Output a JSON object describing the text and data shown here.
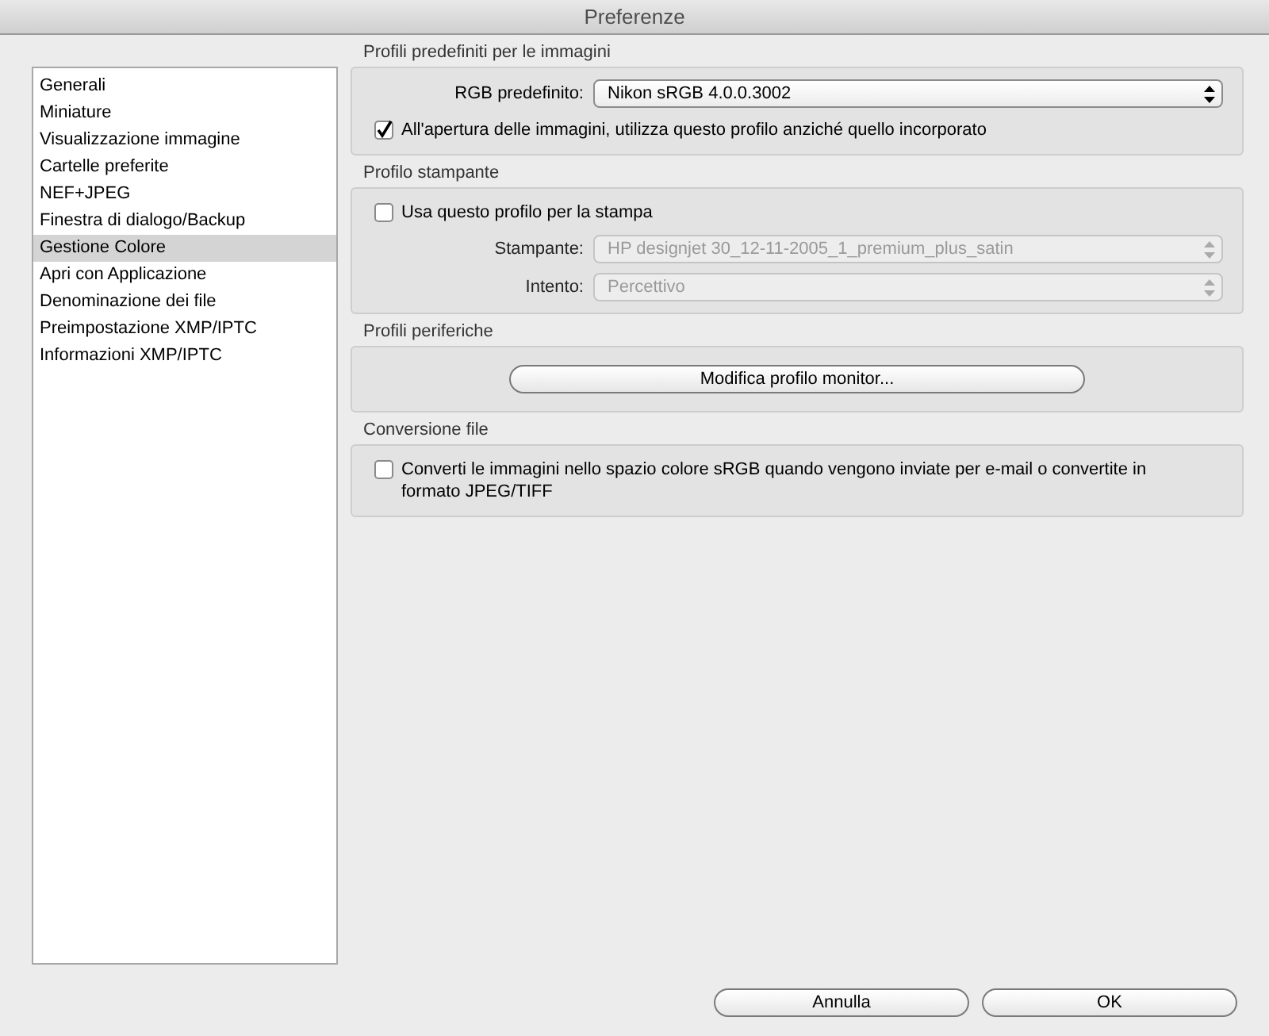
{
  "window": {
    "title": "Preferenze"
  },
  "sidebar": {
    "items": [
      {
        "label": "Generali",
        "selected": false
      },
      {
        "label": "Miniature",
        "selected": false
      },
      {
        "label": "Visualizzazione immagine",
        "selected": false
      },
      {
        "label": "Cartelle preferite",
        "selected": false
      },
      {
        "label": "NEF+JPEG",
        "selected": false
      },
      {
        "label": "Finestra di dialogo/Backup",
        "selected": false
      },
      {
        "label": "Gestione Colore",
        "selected": true
      },
      {
        "label": "Apri con Applicazione",
        "selected": false
      },
      {
        "label": "Denominazione dei file",
        "selected": false
      },
      {
        "label": "Preimpostazione XMP/IPTC",
        "selected": false
      },
      {
        "label": "Informazioni XMP/IPTC",
        "selected": false
      }
    ]
  },
  "sections": [
    {
      "title": "Profili predefiniti per le immagini",
      "rows": [
        {
          "kind": "select",
          "label": "RGB predefinito:",
          "value": "Nikon sRGB 4.0.0.3002",
          "disabled": false
        },
        {
          "kind": "checkbox",
          "label": "All'apertura delle immagini, utilizza questo profilo anziché quello incorporato",
          "checked": true
        }
      ]
    },
    {
      "title": "Profilo stampante",
      "rows": [
        {
          "kind": "checkbox",
          "label": "Usa questo profilo per la stampa",
          "checked": false
        },
        {
          "kind": "select",
          "label": "Stampante:",
          "value": "HP designjet 30_12-11-2005_1_premium_plus_satin",
          "disabled": true
        },
        {
          "kind": "select",
          "label": "Intento:",
          "value": "Percettivo",
          "disabled": true
        }
      ]
    },
    {
      "title": "Profili periferiche",
      "rows": [
        {
          "kind": "button",
          "label": "Modifica profilo monitor..."
        }
      ]
    },
    {
      "title": "Conversione file",
      "rows": [
        {
          "kind": "checkbox",
          "label": "Converti le immagini nello spazio colore sRGB quando vengono inviate per e-mail o convertite in formato JPEG/TIFF",
          "checked": false
        }
      ]
    }
  ],
  "buttons": [
    "Annulla",
    "OK"
  ]
}
